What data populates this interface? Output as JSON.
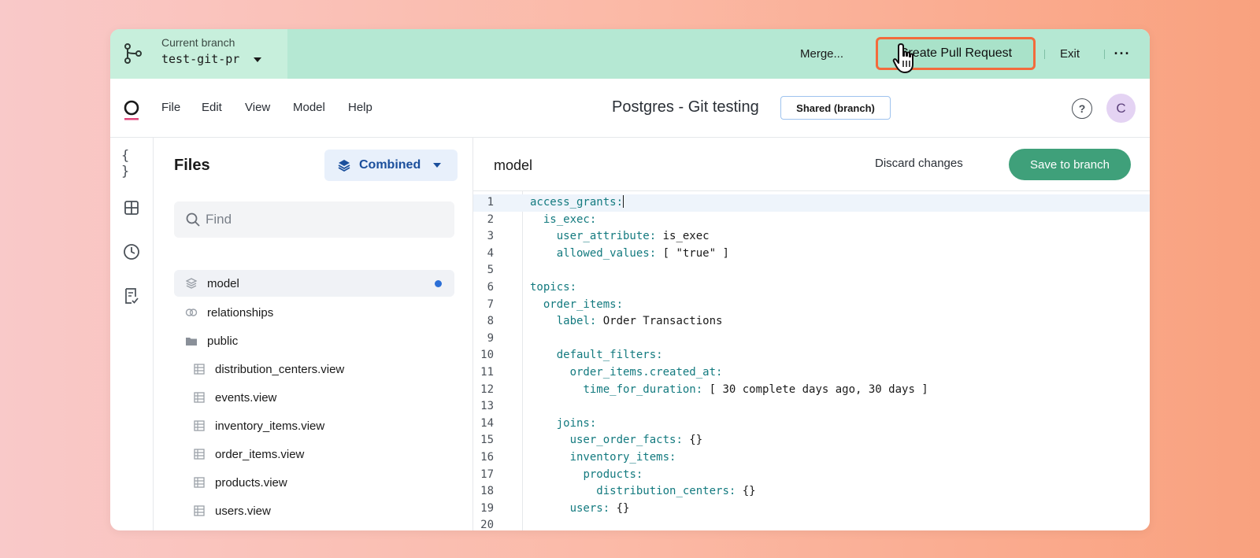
{
  "gitbar": {
    "branch_caption": "Current branch",
    "branch_name": "test-git-pr",
    "merge_label": "Merge...",
    "pr_label": "Create Pull Request",
    "exit_label": "Exit",
    "more_label": "···"
  },
  "menubar": {
    "items": [
      "File",
      "Edit",
      "View",
      "Model",
      "Help"
    ],
    "project_title": "Postgres - Git testing",
    "badge": "Shared (branch)",
    "help": "?",
    "avatar": "C"
  },
  "rail": {
    "icons": [
      "code-braces-icon",
      "grid-icon",
      "history-icon",
      "checklist-icon"
    ],
    "braces_glyph": "{ }"
  },
  "files": {
    "title": "Files",
    "view_mode": "Combined",
    "search_placeholder": "Find",
    "items": [
      {
        "name": "model",
        "icon": "layers-icon",
        "active": true,
        "modified": true
      },
      {
        "name": "relationships",
        "icon": "link-icon"
      },
      {
        "name": "public",
        "icon": "folder-icon"
      },
      {
        "name": "distribution_centers.view",
        "icon": "table-icon"
      },
      {
        "name": "events.view",
        "icon": "table-icon"
      },
      {
        "name": "inventory_items.view",
        "icon": "table-icon"
      },
      {
        "name": "order_items.view",
        "icon": "table-icon"
      },
      {
        "name": "products.view",
        "icon": "table-icon"
      },
      {
        "name": "users.view",
        "icon": "table-icon"
      }
    ]
  },
  "editor": {
    "title": "model",
    "discard_label": "Discard changes",
    "save_label": "Save to branch",
    "lines": [
      {
        "n": "1",
        "indent": "",
        "key": "access_grants:",
        "rest": ""
      },
      {
        "n": "2",
        "indent": "  ",
        "key": "is_exec:",
        "rest": ""
      },
      {
        "n": "3",
        "indent": "    ",
        "key": "user_attribute:",
        "rest": " is_exec"
      },
      {
        "n": "4",
        "indent": "    ",
        "key": "allowed_values:",
        "rest": " [ \"true\" ]"
      },
      {
        "n": "5",
        "indent": "",
        "key": "",
        "rest": ""
      },
      {
        "n": "6",
        "indent": "",
        "key": "topics:",
        "rest": ""
      },
      {
        "n": "7",
        "indent": "  ",
        "key": "order_items:",
        "rest": ""
      },
      {
        "n": "8",
        "indent": "    ",
        "key": "label:",
        "rest": " Order Transactions"
      },
      {
        "n": "9",
        "indent": "",
        "key": "",
        "rest": ""
      },
      {
        "n": "10",
        "indent": "    ",
        "key": "default_filters:",
        "rest": ""
      },
      {
        "n": "11",
        "indent": "      ",
        "key": "order_items.created_at:",
        "rest": ""
      },
      {
        "n": "12",
        "indent": "        ",
        "key": "time_for_duration:",
        "rest": " [ 30 complete days ago, 30 days ]"
      },
      {
        "n": "13",
        "indent": "",
        "key": "",
        "rest": ""
      },
      {
        "n": "14",
        "indent": "    ",
        "key": "joins:",
        "rest": ""
      },
      {
        "n": "15",
        "indent": "      ",
        "key": "user_order_facts:",
        "rest": " {}"
      },
      {
        "n": "16",
        "indent": "      ",
        "key": "inventory_items:",
        "rest": ""
      },
      {
        "n": "17",
        "indent": "        ",
        "key": "products:",
        "rest": ""
      },
      {
        "n": "18",
        "indent": "          ",
        "key": "distribution_centers:",
        "rest": " {}"
      },
      {
        "n": "19",
        "indent": "      ",
        "key": "users:",
        "rest": " {}"
      },
      {
        "n": "20",
        "indent": "",
        "key": "",
        "rest": ""
      }
    ]
  },
  "colors": {
    "gitbar_bg": "#b5e8d3",
    "pr_highlight": "#f36b3c",
    "save_button": "#3fa07a",
    "yaml_key": "#137a7f",
    "accent_blue": "#1b4f9c"
  }
}
